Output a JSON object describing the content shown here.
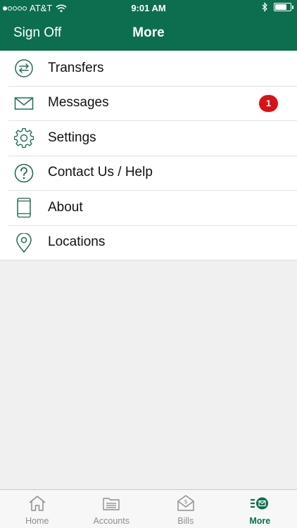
{
  "status_bar": {
    "carrier": "AT&T",
    "time": "9:01 AM"
  },
  "header": {
    "left_button": "Sign Off",
    "title": "More"
  },
  "menu": [
    {
      "label": "Transfers",
      "icon": "transfer-arrows-icon"
    },
    {
      "label": "Messages",
      "icon": "envelope-icon",
      "badge": "1"
    },
    {
      "label": "Settings",
      "icon": "gear-icon"
    },
    {
      "label": "Contact Us / Help",
      "icon": "question-circle-icon"
    },
    {
      "label": "About",
      "icon": "phone-device-icon"
    },
    {
      "label": "Locations",
      "icon": "map-pin-icon"
    }
  ],
  "tabs": [
    {
      "label": "Home",
      "icon": "house-icon",
      "active": false
    },
    {
      "label": "Accounts",
      "icon": "accounts-icon",
      "active": false
    },
    {
      "label": "Bills",
      "icon": "bill-envelope-icon",
      "active": false
    },
    {
      "label": "More",
      "icon": "more-icon",
      "active": true
    }
  ],
  "colors": {
    "brand": "#0c6e4f",
    "badge": "#d81216",
    "icon_stroke": "#1f6e55",
    "tab_inactive": "#8e8e8e"
  }
}
